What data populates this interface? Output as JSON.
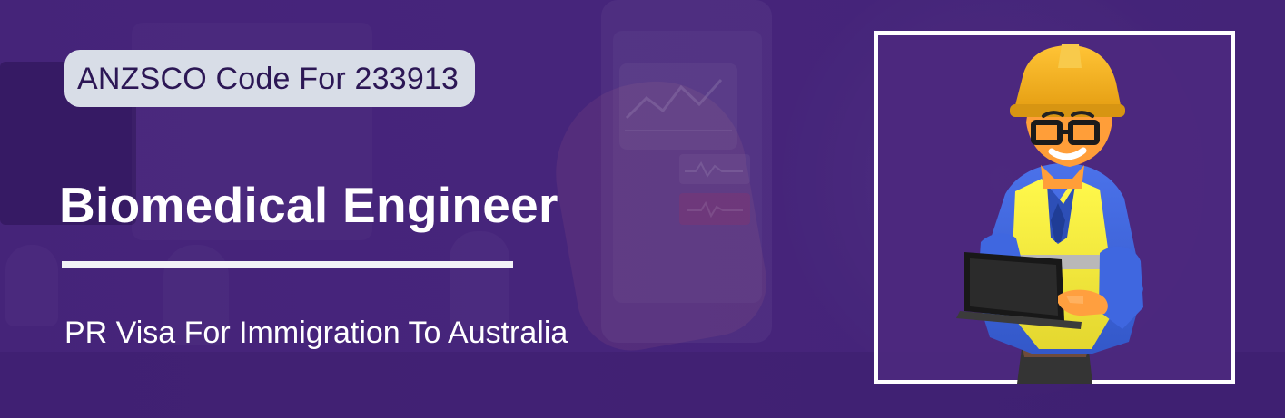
{
  "banner": {
    "code_label": "ANZSCO Code For 233913",
    "title": "Biomedical Engineer",
    "subtitle": "PR Visa For Immigration To Australia"
  },
  "colors": {
    "background": "#4a2a7d",
    "badge_background": "#d8dde7",
    "badge_text": "#2c1755",
    "title_text": "#ffffff",
    "frame_border": "#ffffff",
    "helmet": "#f3b31c",
    "vest": "#f4f13c",
    "reflective_stripe": "#b9b8b8",
    "shirt": "#3f67e0",
    "laptop": "#202020"
  }
}
